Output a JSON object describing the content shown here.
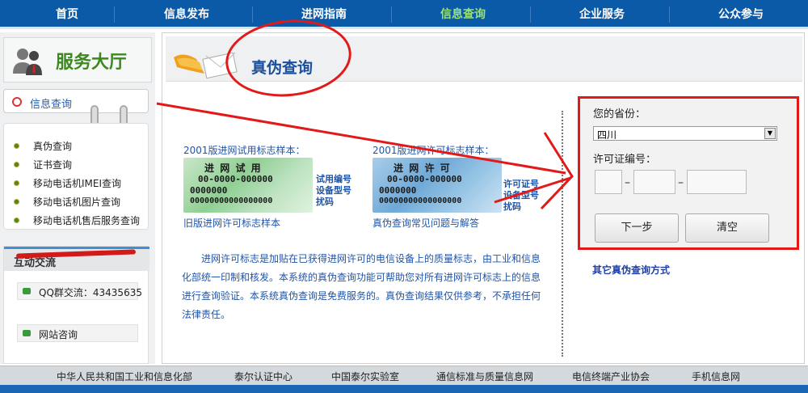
{
  "nav": {
    "items": [
      "首页",
      "信息发布",
      "进网指南",
      "信息查询",
      "企业服务",
      "公众参与"
    ],
    "active_index": 3
  },
  "sidebar": {
    "title": "服务大厅",
    "info_tab": "信息查询",
    "menu": [
      "真伪查询",
      "证书查询",
      "移动电话机IMEI查询",
      "移动电话机图片查询",
      "移动电话机售后服务查询"
    ],
    "interact": {
      "title": "互动交流",
      "items": [
        "QQ群交流：43435635",
        "网站咨询"
      ]
    }
  },
  "main": {
    "title": "真伪查询",
    "sample1": {
      "label": "2001版进网试用标志样本：",
      "card_title": "进 网 试 用",
      "card_lines": [
        "00-0000-000000",
        "0000000",
        "00000000000000000"
      ],
      "side_labels": [
        "试用编号",
        "设备型号",
        "扰码"
      ],
      "link": "旧版进网许可标志样本"
    },
    "sample2": {
      "label": "2001版进网许可标志样本：",
      "card_title": "进 网 许 可",
      "card_lines": [
        "00-0000-000000",
        "0000000",
        "00000000000000000"
      ],
      "side_labels": [
        "许可证号",
        "设备型号",
        "扰码"
      ],
      "link": "真伪查询常见问题与解答"
    },
    "paragraph": "进网许可标志是加贴在已获得进网许可的电信设备上的质量标志，由工业和信息化部统一印制和核发。本系统的真伪查询功能可帮助您对所有进网许可标志上的信息进行查询验证。本系统真伪查询是免费服务的。真伪查询结果仅供参考，不承担任何法律责任。",
    "form": {
      "province_label": "您的省份：",
      "province_value": "四川",
      "license_label": "许可证编号：",
      "next_button": "下一步",
      "clear_button": "清空"
    },
    "other_link": "其它真伪查询方式"
  },
  "footer": {
    "links": [
      "中华人民共和国工业和信息化部",
      "泰尔认证中心",
      "中国泰尔实验室",
      "通信标准与质量信息网",
      "电信终端产业协会",
      "手机信息网"
    ]
  },
  "colors": {
    "nav_bg": "#0a5aa8",
    "nav_active": "#9be27a",
    "annotation_red": "#e31919",
    "link_blue": "#1f55a8",
    "sidebar_title_green": "#3a8a1c"
  }
}
